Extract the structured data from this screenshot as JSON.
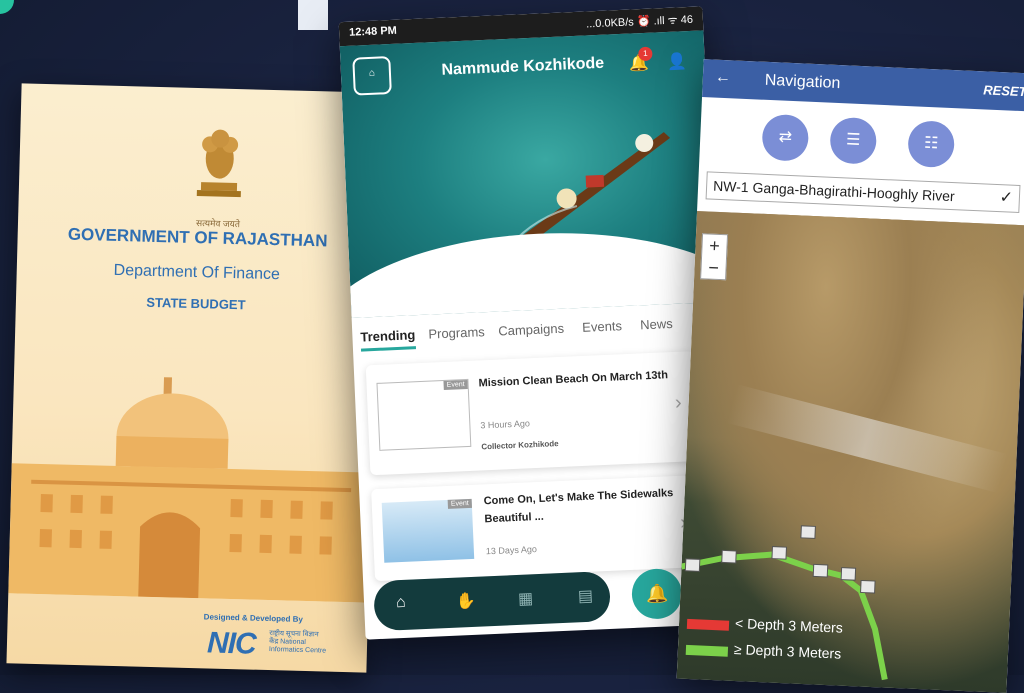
{
  "left_card": {
    "emblem_caption": "सत्यमेव जयते",
    "title": "GOVERNMENT OF RAJASTHAN",
    "department": "Department Of Finance",
    "subtitle": "STATE BUDGET",
    "designed_by": "Designed & Developed By",
    "nic_logo": "NIC",
    "nic_sub": "राष्ट्रीय सूचना विज्ञान केंद्र National Informatics Centre"
  },
  "phone": {
    "status": {
      "time": "12:48 PM",
      "indicators": "...0.0KB/s ⏰ .ıll ᯤ 46"
    },
    "header": {
      "title": "Nammude Kozhikode",
      "notification_count": "1"
    },
    "tabs": [
      "Trending",
      "Programs",
      "Campaigns",
      "Events",
      "News"
    ],
    "active_tab": "Trending",
    "cards": [
      {
        "tag": "Event",
        "title": "Mission Clean Beach On March 13th",
        "time": "3 Hours Ago",
        "author": "Collector Kozhikode"
      },
      {
        "tag": "Event",
        "title": "Come On, Let's Make The Sidewalks Beautiful ...",
        "time": "13 Days Ago"
      }
    ],
    "icons": [
      "logo-icon",
      "bell-icon",
      "user-icon",
      "home-icon",
      "hand-icon",
      "grid-icon",
      "chat-icon",
      "bell-fab-icon"
    ]
  },
  "nav_phone": {
    "title": "Navigation",
    "reset": "RESET",
    "selected_river": "NW-1 Ganga-Bhagirathi-Hooghly River",
    "zoom_in": "+",
    "zoom_out": "−",
    "legend": [
      {
        "label": "< Depth 3 Meters",
        "color": "#e53935"
      },
      {
        "label": "≥ Depth 3 Meters",
        "color": "#7cd14a"
      }
    ]
  }
}
